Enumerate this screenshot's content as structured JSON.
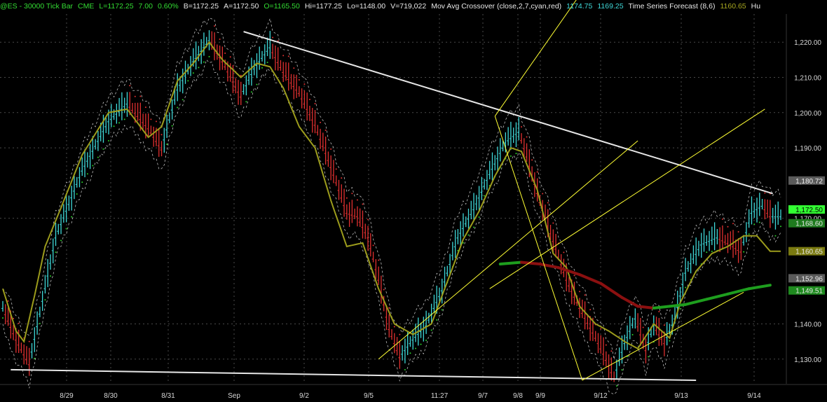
{
  "header": {
    "symbol": "@ES - 30000 Tick Bar",
    "exchange": "CME",
    "last": "L=1172.25",
    "change": "7.00",
    "change_pct": "0.60%",
    "bid": "B=1172.25",
    "ask": "A=1172.50",
    "open": "O=1165.50",
    "high": "Hi=1177.25",
    "low": "Lo=1148.00",
    "volume": "V=719,022",
    "mac_name": "Mov Avg Crossover (close,2,7,cyan,red)",
    "mac_val1": "1174.75",
    "mac_val2": "1169.25",
    "tsf_name": "Time Series Forecast (8,6)",
    "tsf_val": "1160.65",
    "truncated": "Hu"
  },
  "colors": {
    "background": "#000000",
    "up_bar": "#3fd8d8",
    "down_bar": "#e03030",
    "forecast_line": "#9c9c1c",
    "band": "#bbbbbb",
    "trendline": "#e6e6e6",
    "channel": "#ffff33",
    "long_ma_up": "#1e9e1e",
    "long_ma_down": "#8b1010",
    "grid": "#4a4a4a"
  },
  "chart_data": {
    "type": "candlestick",
    "yrange": [
      1123,
      1228
    ],
    "y_ticks": [
      {
        "value": 1220,
        "label": "1,220.00"
      },
      {
        "value": 1210,
        "label": "1,210.00"
      },
      {
        "value": 1200,
        "label": "1,200.00"
      },
      {
        "value": 1190,
        "label": "1,190.00"
      },
      {
        "value": 1170,
        "label": "1,170.00"
      },
      {
        "value": 1140,
        "label": "1,140.00"
      },
      {
        "value": 1130,
        "label": "1,130.00"
      }
    ],
    "x_labels": [
      "8/29",
      "8/30",
      "8/31",
      "Sep",
      "9/2",
      "9/5",
      "11:27",
      "9/7",
      "9/8",
      "9/9",
      "9/12",
      "9/13",
      "9/14"
    ],
    "price_path": [
      [
        0,
        1145
      ],
      [
        5,
        1136
      ],
      [
        10,
        1129
      ],
      [
        20,
        1165
      ],
      [
        30,
        1184
      ],
      [
        40,
        1198
      ],
      [
        47,
        1203
      ],
      [
        55,
        1196
      ],
      [
        60,
        1190
      ],
      [
        66,
        1207
      ],
      [
        72,
        1215
      ],
      [
        78,
        1221
      ],
      [
        83,
        1215
      ],
      [
        90,
        1205
      ],
      [
        95,
        1213
      ],
      [
        101,
        1219
      ],
      [
        106,
        1212
      ],
      [
        112,
        1206
      ],
      [
        118,
        1197
      ],
      [
        124,
        1185
      ],
      [
        130,
        1172
      ],
      [
        134,
        1171
      ],
      [
        138,
        1165
      ],
      [
        142,
        1153
      ],
      [
        146,
        1139
      ],
      [
        150,
        1131
      ],
      [
        155,
        1136
      ],
      [
        160,
        1140
      ],
      [
        166,
        1150
      ],
      [
        172,
        1165
      ],
      [
        178,
        1173
      ],
      [
        184,
        1183
      ],
      [
        190,
        1192
      ],
      [
        195,
        1195
      ],
      [
        198,
        1188
      ],
      [
        203,
        1175
      ],
      [
        208,
        1164
      ],
      [
        213,
        1153
      ],
      [
        218,
        1145
      ],
      [
        223,
        1138
      ],
      [
        227,
        1132
      ],
      [
        231,
        1125
      ],
      [
        235,
        1135
      ],
      [
        239,
        1142
      ],
      [
        243,
        1133
      ],
      [
        246,
        1140
      ],
      [
        250,
        1135
      ],
      [
        254,
        1142
      ],
      [
        258,
        1155
      ],
      [
        264,
        1163
      ],
      [
        270,
        1165
      ],
      [
        275,
        1163
      ],
      [
        279,
        1161
      ],
      [
        283,
        1172
      ],
      [
        287,
        1174
      ],
      [
        290,
        1171
      ]
    ],
    "forecast_path": [
      [
        0,
        1150
      ],
      [
        5,
        1138
      ],
      [
        8,
        1135
      ],
      [
        12,
        1148
      ],
      [
        16,
        1162
      ],
      [
        22,
        1173
      ],
      [
        30,
        1188
      ],
      [
        40,
        1200
      ],
      [
        47,
        1201
      ],
      [
        55,
        1193
      ],
      [
        60,
        1196
      ],
      [
        66,
        1209
      ],
      [
        72,
        1214
      ],
      [
        78,
        1220
      ],
      [
        83,
        1215
      ],
      [
        90,
        1210
      ],
      [
        96,
        1214
      ],
      [
        101,
        1213
      ],
      [
        106,
        1207
      ],
      [
        112,
        1196
      ],
      [
        118,
        1190
      ],
      [
        124,
        1175
      ],
      [
        130,
        1162
      ],
      [
        136,
        1163
      ],
      [
        142,
        1150
      ],
      [
        148,
        1140
      ],
      [
        155,
        1137
      ],
      [
        162,
        1140
      ],
      [
        168,
        1152
      ],
      [
        174,
        1164
      ],
      [
        180,
        1172
      ],
      [
        186,
        1182
      ],
      [
        192,
        1190
      ],
      [
        196,
        1189
      ],
      [
        202,
        1178
      ],
      [
        208,
        1160
      ],
      [
        213,
        1156
      ],
      [
        218,
        1145
      ],
      [
        224,
        1140
      ],
      [
        229,
        1138
      ],
      [
        235,
        1135
      ],
      [
        240,
        1133
      ],
      [
        246,
        1140
      ],
      [
        252,
        1136
      ],
      [
        256,
        1146
      ],
      [
        262,
        1155
      ],
      [
        268,
        1160
      ],
      [
        274,
        1162
      ],
      [
        280,
        1165
      ],
      [
        285,
        1165
      ],
      [
        290,
        1160.65
      ]
    ],
    "long_ma": [
      [
        188,
        1157
      ],
      [
        196,
        1157.5
      ],
      [
        203,
        1157
      ],
      [
        210,
        1156
      ],
      [
        218,
        1154
      ],
      [
        226,
        1151.5
      ],
      [
        234,
        1147.5
      ],
      [
        240,
        1145
      ],
      [
        246,
        1144.5
      ],
      [
        252,
        1145
      ],
      [
        258,
        1145.5
      ],
      [
        266,
        1147
      ],
      [
        274,
        1148.5
      ],
      [
        282,
        1150
      ],
      [
        290,
        1151
      ]
    ],
    "trendlines": [
      {
        "from": [
          91,
          1223
        ],
        "to": [
          291,
          1177
        ]
      },
      {
        "from": [
          3,
          1127
        ],
        "to": [
          262,
          1124
        ]
      },
      {
        "from": [
          142,
          1130
        ],
        "to": [
          240,
          1192
        ]
      },
      {
        "from": [
          186,
          1199
        ],
        "to": [
          219,
          1124
        ]
      },
      {
        "from": [
          186,
          1199
        ],
        "to": [
          240,
          1257
        ]
      },
      {
        "from": [
          219,
          1124
        ],
        "to": [
          280,
          1149
        ]
      },
      {
        "from": [
          184,
          1150
        ],
        "to": [
          288,
          1201
        ]
      }
    ],
    "price_tags": [
      {
        "label": "1,180.72",
        "value": 1180.72,
        "bg": "#5a5a5a",
        "fg": "#f0f0f0"
      },
      {
        "label": "1,172.50",
        "value": 1172.5,
        "bg": "#33ff33",
        "fg": "#000000"
      },
      {
        "label": "1,168.60",
        "value": 1168.6,
        "bg": "#1e7a1e",
        "fg": "#e8e8e8"
      },
      {
        "label": "1,160.65",
        "value": 1160.65,
        "bg": "#7a7a10",
        "fg": "#e8e8e8"
      },
      {
        "label": "1,152.96",
        "value": 1152.96,
        "bg": "#5a5a5a",
        "fg": "#f0f0f0"
      },
      {
        "label": "1,149.51",
        "value": 1149.51,
        "bg": "#1e8a1e",
        "fg": "#e8e8e8"
      }
    ]
  }
}
